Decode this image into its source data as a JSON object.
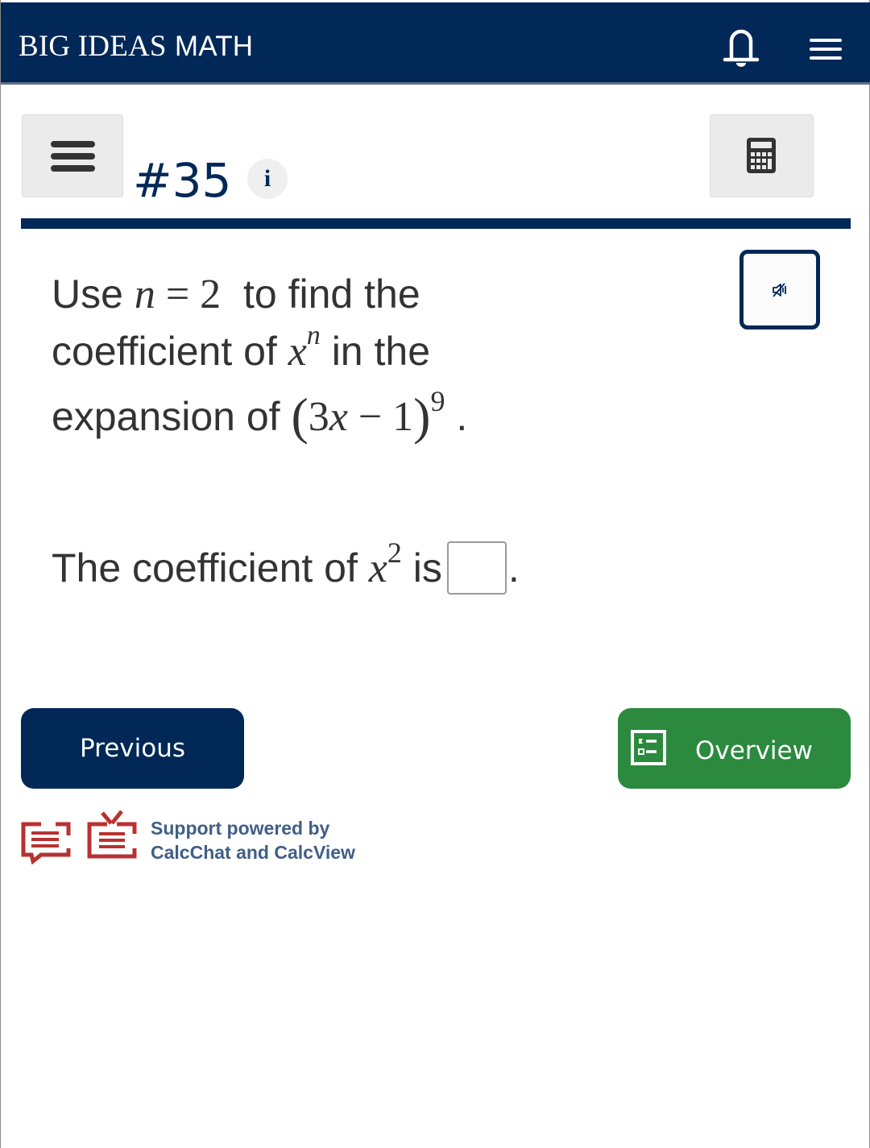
{
  "header": {
    "brand_part1": "BIG IDEAS",
    "brand_part2": "MATH",
    "icons": [
      "bell-icon",
      "hamburger-menu-icon"
    ]
  },
  "question_bar": {
    "menu_icon": "hamburger-menu-icon",
    "number": "#35",
    "info_glyph": "i",
    "calculator_icon": "calculator-icon"
  },
  "audio": {
    "icon": "speaker-muted-icon"
  },
  "problem": {
    "line1_pre": "Use ",
    "line1_var": "n",
    "line1_eq": " = 2",
    "line1_post": " to find the",
    "line2_pre": "coefficient of ",
    "line2_base": "x",
    "line2_exp": "n",
    "line2_post": " in the",
    "line3_pre": "expansion of ",
    "line3_open": "(",
    "line3_inner_num": "3",
    "line3_inner_var": "x",
    "line3_inner_rest": " − 1",
    "line3_close": ")",
    "line3_exp": "9",
    "line3_end": " ."
  },
  "answer": {
    "pre": "The coefficient of ",
    "base": "x",
    "exp": "2",
    "mid": " is",
    "value": "",
    "end": "."
  },
  "nav": {
    "previous_label": "Previous",
    "overview_label": "Overview"
  },
  "support": {
    "line1": "Support powered by",
    "line2": "CalcChat and CalcView"
  },
  "colors": {
    "brand_navy": "#012857",
    "overview_green": "#2b8a3e",
    "support_red": "#b83232",
    "support_text": "#3f5f86"
  }
}
